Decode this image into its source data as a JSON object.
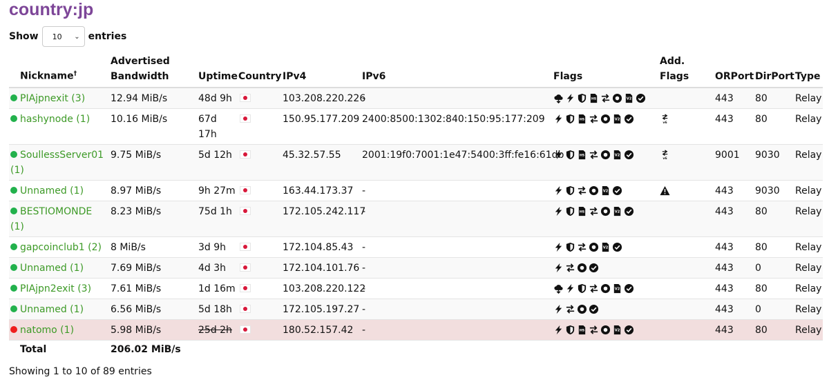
{
  "title": "country:jp",
  "length": {
    "show": "Show",
    "value": "10",
    "entries": "entries"
  },
  "columns": {
    "nickname": "Nickname",
    "dagger": "†",
    "bandwidth": "Advertised Bandwidth",
    "uptime": "Uptime",
    "country": "Country",
    "ipv4": "IPv4",
    "ipv6": "IPv6",
    "flags": "Flags",
    "addflags": "Add. Flags",
    "orport": "ORPort",
    "dirport": "DirPort",
    "type": "Type"
  },
  "rows": [
    {
      "status": "up",
      "nick": "PIAjpnexit",
      "family": "3",
      "bw": "12.94 MiB/s",
      "uptime": "48d 9h",
      "ipv4": "103.208.220.226",
      "ipv6": "-",
      "flags": [
        "exit-icon",
        "fast-icon",
        "guard-icon",
        "hsdir-icon",
        "running-icon",
        "stable-icon",
        "v2dir-icon",
        "valid-icon"
      ],
      "addflags": [],
      "orport": "443",
      "dirport": "80",
      "type": "Relay"
    },
    {
      "status": "up",
      "nick": "hashynode",
      "family": "1",
      "bw": "10.16 MiB/s",
      "uptime": "67d 17h",
      "ipv4": "150.95.177.209",
      "ipv6": "2400:8500:1302:840:150:95:177:209",
      "flags": [
        "fast-icon",
        "guard-icon",
        "hsdir-icon",
        "running-icon",
        "stable-icon",
        "v2dir-icon",
        "valid-icon"
      ],
      "addflags": [
        "ipv6-icon"
      ],
      "orport": "443",
      "dirport": "80",
      "type": "Relay"
    },
    {
      "status": "up",
      "nick": "SoullessServer01",
      "family": "1",
      "bw": "9.75 MiB/s",
      "uptime": "5d 12h",
      "ipv4": "45.32.57.55",
      "ipv6": "2001:19f0:7001:1e47:5400:3ff:fe16:61db",
      "flags": [
        "fast-icon",
        "guard-icon",
        "hsdir-icon",
        "running-icon",
        "stable-icon",
        "v2dir-icon",
        "valid-icon"
      ],
      "addflags": [
        "ipv6-icon"
      ],
      "orport": "9001",
      "dirport": "9030",
      "type": "Relay"
    },
    {
      "status": "up",
      "nick": "Unnamed",
      "family": "1",
      "bw": "8.97 MiB/s",
      "uptime": "9h 27m",
      "ipv4": "163.44.173.37",
      "ipv6": "-",
      "flags": [
        "fast-icon",
        "guard-icon",
        "running-icon",
        "stable-icon",
        "v2dir-icon",
        "valid-icon"
      ],
      "addflags": [
        "warning-icon"
      ],
      "orport": "443",
      "dirport": "9030",
      "type": "Relay"
    },
    {
      "status": "up",
      "nick": "BESTIOMONDE",
      "family": "1",
      "bw": "8.23 MiB/s",
      "uptime": "75d 1h",
      "ipv4": "172.105.242.117",
      "ipv6": "-",
      "flags": [
        "fast-icon",
        "guard-icon",
        "hsdir-icon",
        "running-icon",
        "stable-icon",
        "v2dir-icon",
        "valid-icon"
      ],
      "addflags": [],
      "orport": "443",
      "dirport": "80",
      "type": "Relay"
    },
    {
      "status": "up",
      "nick": "gapcoinclub1",
      "family": "2",
      "bw": "8 MiB/s",
      "uptime": "3d 9h",
      "ipv4": "172.104.85.43",
      "ipv6": "-",
      "flags": [
        "fast-icon",
        "guard-icon",
        "running-icon",
        "stable-icon",
        "v2dir-icon",
        "valid-icon"
      ],
      "addflags": [],
      "orport": "443",
      "dirport": "80",
      "type": "Relay"
    },
    {
      "status": "up",
      "nick": "Unnamed",
      "family": "1",
      "bw": "7.69 MiB/s",
      "uptime": "4d 3h",
      "ipv4": "172.104.101.76",
      "ipv6": "-",
      "flags": [
        "fast-icon",
        "running-icon",
        "stable-icon",
        "valid-icon"
      ],
      "addflags": [],
      "orport": "443",
      "dirport": "0",
      "type": "Relay"
    },
    {
      "status": "up",
      "nick": "PIAjpn2exit",
      "family": "3",
      "bw": "7.61 MiB/s",
      "uptime": "1d 16m",
      "ipv4": "103.208.220.122",
      "ipv6": "-",
      "flags": [
        "exit-icon",
        "fast-icon",
        "guard-icon",
        "running-icon",
        "stable-icon",
        "v2dir-icon",
        "valid-icon"
      ],
      "addflags": [],
      "orport": "443",
      "dirport": "80",
      "type": "Relay"
    },
    {
      "status": "up",
      "nick": "Unnamed",
      "family": "1",
      "bw": "6.56 MiB/s",
      "uptime": "5d 18h",
      "ipv4": "172.105.197.27",
      "ipv6": "-",
      "flags": [
        "fast-icon",
        "running-icon",
        "stable-icon",
        "valid-icon"
      ],
      "addflags": [],
      "orport": "443",
      "dirport": "0",
      "type": "Relay"
    },
    {
      "status": "down",
      "nick": "natomo",
      "family": "1",
      "bw": "5.98 MiB/s",
      "uptime": "25d 2h",
      "ipv4": "180.52.157.42",
      "ipv6": "-",
      "flags": [
        "fast-icon",
        "guard-icon",
        "hsdir-icon",
        "running-icon",
        "stable-icon",
        "v2dir-icon",
        "valid-icon"
      ],
      "addflags": [],
      "orport": "443",
      "dirport": "80",
      "type": "Relay"
    }
  ],
  "total": {
    "label": "Total",
    "bw": "206.02 MiB/s"
  },
  "info": "Showing 1 to 10 of 89 entries",
  "colors": {
    "title": "#7d4698",
    "link": "#3d9a27",
    "up": "#22b14c",
    "down": "#ef1e1e",
    "down_row": "#f2dede"
  }
}
